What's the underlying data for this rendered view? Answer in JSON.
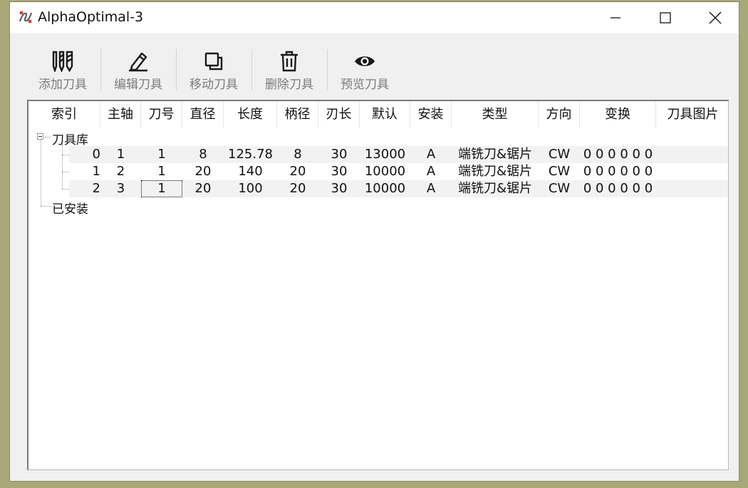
{
  "window": {
    "title": "AlphaOptimal-3"
  },
  "toolbar": {
    "add_label": "添加刀具",
    "edit_label": "编辑刀具",
    "move_label": "移动刀具",
    "delete_label": "删除刀具",
    "preview_label": "预览刀具"
  },
  "table": {
    "columns": [
      "索引",
      "主轴",
      "刀号",
      "直径",
      "长度",
      "柄径",
      "刃长",
      "默认",
      "安装",
      "类型",
      "方向",
      "变换",
      "刀具图片"
    ],
    "tree_root": "刀具库",
    "tree_installed": "已安装",
    "rows": [
      [
        "0",
        "1",
        "1",
        "8",
        "125.78",
        "8",
        "30",
        "13000",
        "A",
        "端铣刀&锯片",
        "CW",
        "0 0 0 0 0 0",
        ""
      ],
      [
        "1",
        "2",
        "1",
        "20",
        "140",
        "20",
        "30",
        "10000",
        "A",
        "端铣刀&锯片",
        "CW",
        "0 0 0 0 0 0",
        ""
      ],
      [
        "2",
        "3",
        "1",
        "20",
        "100",
        "20",
        "30",
        "10000",
        "A",
        "端铣刀&锯片",
        "CW",
        "0 0 0 0 0 0",
        ""
      ]
    ],
    "selected_cell": {
      "row": 2,
      "column": "刀号"
    }
  },
  "icons": {
    "app": "alphaoptimal-logo-icon",
    "add": "end-mill-icon",
    "edit": "pencil-icon",
    "move": "copy-icon",
    "delete": "trash-icon",
    "preview": "eye-icon"
  }
}
